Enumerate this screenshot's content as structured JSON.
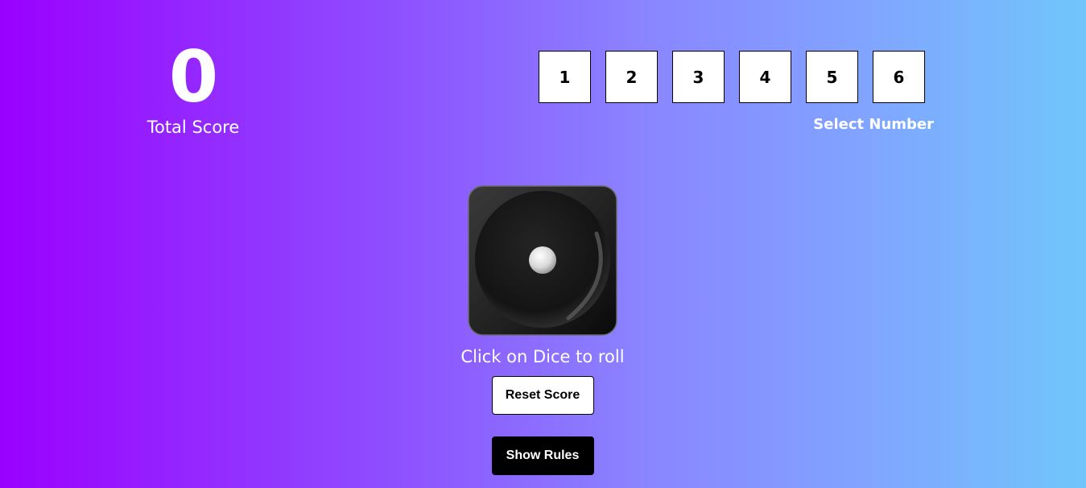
{
  "score": {
    "value": "0",
    "label": "Total Score"
  },
  "selector": {
    "numbers": [
      "1",
      "2",
      "3",
      "4",
      "5",
      "6"
    ],
    "label": "Select Number"
  },
  "dice": {
    "face": 1,
    "hint": "Click on Dice to roll"
  },
  "buttons": {
    "reset_label": "Reset Score",
    "rules_label": "Show Rules"
  },
  "colors": {
    "gradient_start": "#9a00ff",
    "gradient_end": "#70c6fb",
    "dice_body": "#1c1c1c",
    "button_dark": "#000000",
    "button_light": "#ffffff"
  }
}
